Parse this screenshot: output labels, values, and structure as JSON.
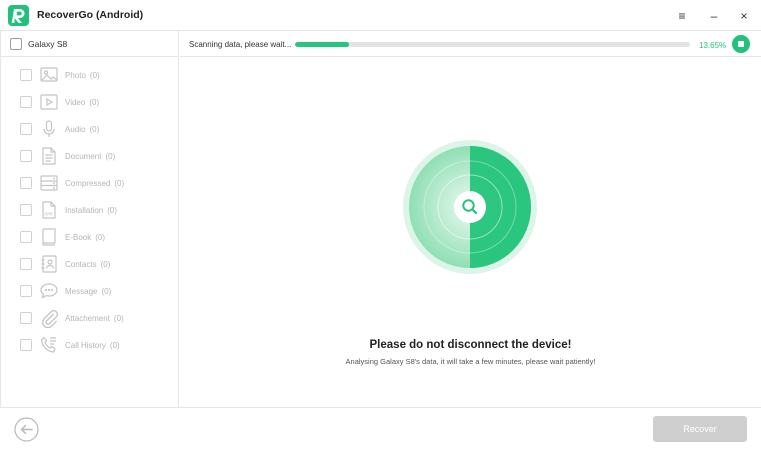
{
  "app": {
    "title": "RecoverGo (Android)"
  },
  "window_controls": {
    "menu": "≡",
    "minimize": "–",
    "close": "×"
  },
  "device": {
    "name": "Galaxy S8"
  },
  "categories": [
    {
      "label": "Photo",
      "count": "(0)",
      "icon": "photo-icon"
    },
    {
      "label": "Video",
      "count": "(0)",
      "icon": "video-icon"
    },
    {
      "label": "Audio",
      "count": "(0)",
      "icon": "microphone-icon"
    },
    {
      "label": "Document",
      "count": "(0)",
      "icon": "document-icon"
    },
    {
      "label": "Compressed",
      "count": "(0)",
      "icon": "compressed-icon"
    },
    {
      "label": "Installation",
      "count": "(0)",
      "icon": "apk-icon"
    },
    {
      "label": "E-Book",
      "count": "(0)",
      "icon": "ebook-icon"
    },
    {
      "label": "Contacts",
      "count": "(0)",
      "icon": "contacts-icon"
    },
    {
      "label": "Message",
      "count": "(0)",
      "icon": "message-icon"
    },
    {
      "label": "Attachement",
      "count": "(0)",
      "icon": "attachment-icon"
    },
    {
      "label": "Call History",
      "count": "(0)",
      "icon": "call-history-icon"
    }
  ],
  "scan": {
    "status": "Scanning data, please wait...",
    "percent_text": "13.65%",
    "progress": 0.1365
  },
  "center": {
    "headline": "Please do not disconnect the device!",
    "subline": "Analysing Galaxy S8's data, it will take a few minutes, please wait patiently!"
  },
  "footer": {
    "recover_label": "Recover"
  },
  "colors": {
    "accent": "#27c57f",
    "disabled": "#cfcfcf"
  }
}
